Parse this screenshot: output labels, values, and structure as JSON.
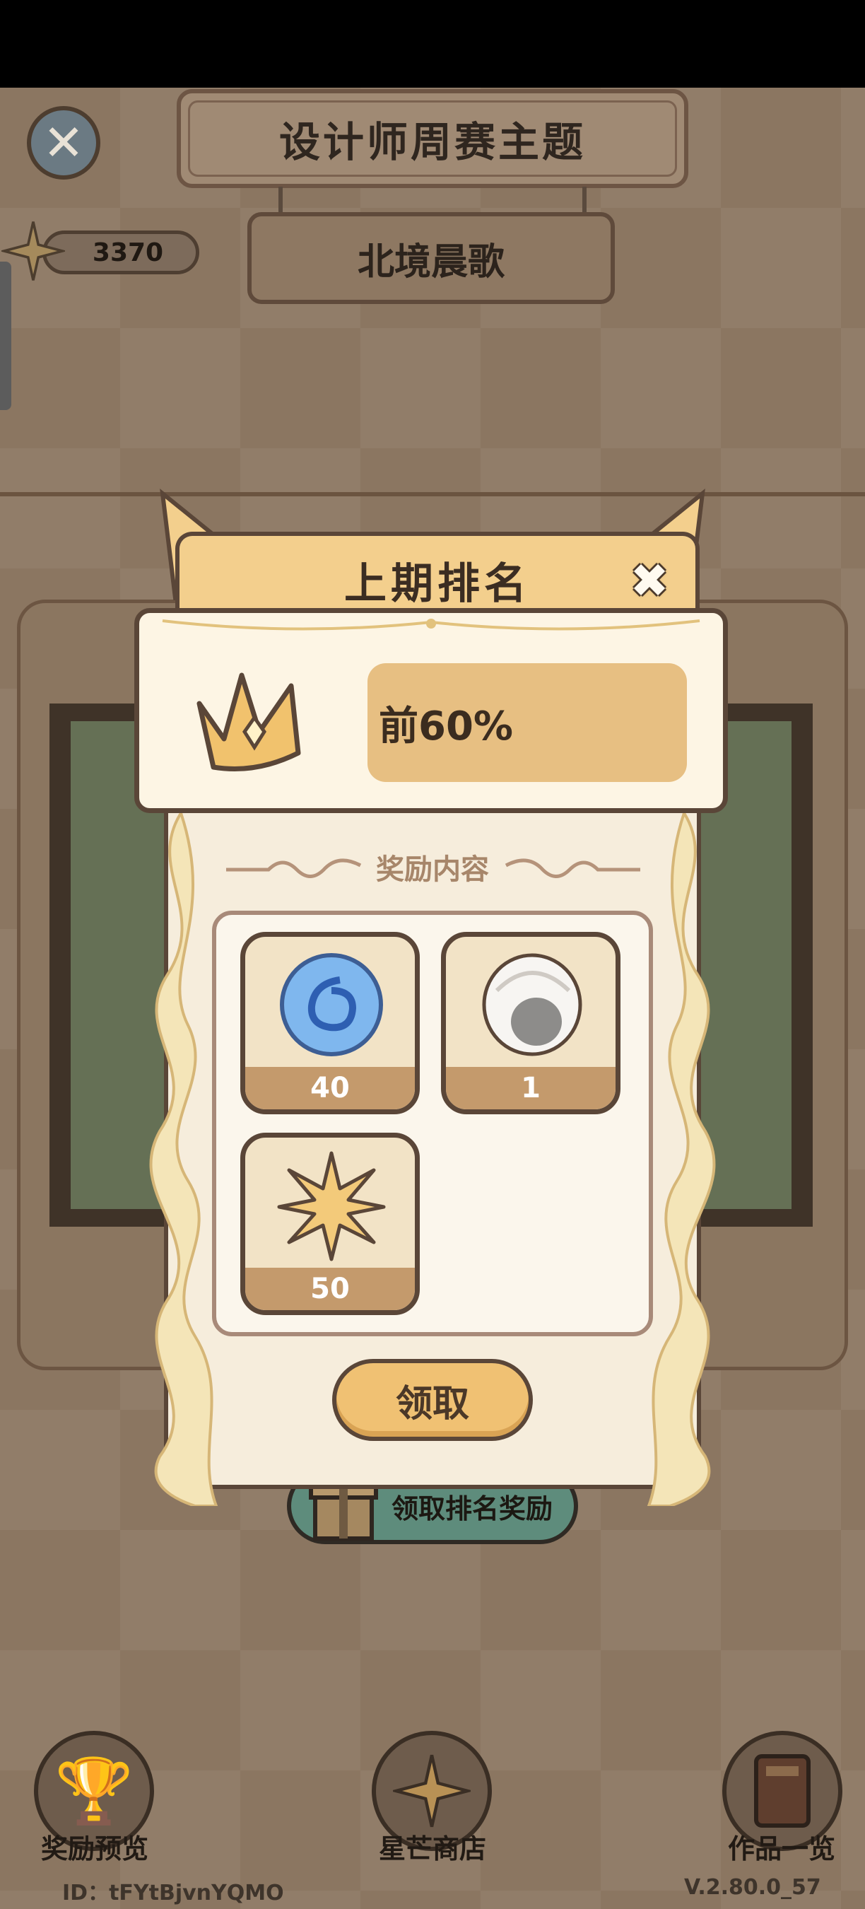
{
  "header": {
    "title": "设计师周赛主题",
    "subtitle": "北境晨歌",
    "score": "3370"
  },
  "modal": {
    "title": "上期排名",
    "rank": "前60%",
    "section_title": "奖励内容",
    "rewards": [
      {
        "icon": "blue-swirl-orb-icon",
        "count": "40"
      },
      {
        "icon": "white-hair-wig-icon",
        "count": "1"
      },
      {
        "icon": "gold-star-icon",
        "count": "50"
      }
    ],
    "claim_label": "领取"
  },
  "background": {
    "claim_rank_reward_label": "领取排名奖励"
  },
  "bottom_nav": {
    "items": [
      {
        "label": "奖励预览",
        "icon": "trophy-icon"
      },
      {
        "label": "星芒商店",
        "icon": "star-icon"
      },
      {
        "label": "作品一览",
        "icon": "book-icon"
      }
    ]
  },
  "footer": {
    "user_id": "ID：tFYtBjvnYQMO",
    "version": "V.2.80.0_57"
  },
  "colors": {
    "modal_header": "#f3cf8d",
    "rank_pill": "#e7bf82",
    "claim_button": "#f0c173",
    "outline": "#5a4638"
  }
}
